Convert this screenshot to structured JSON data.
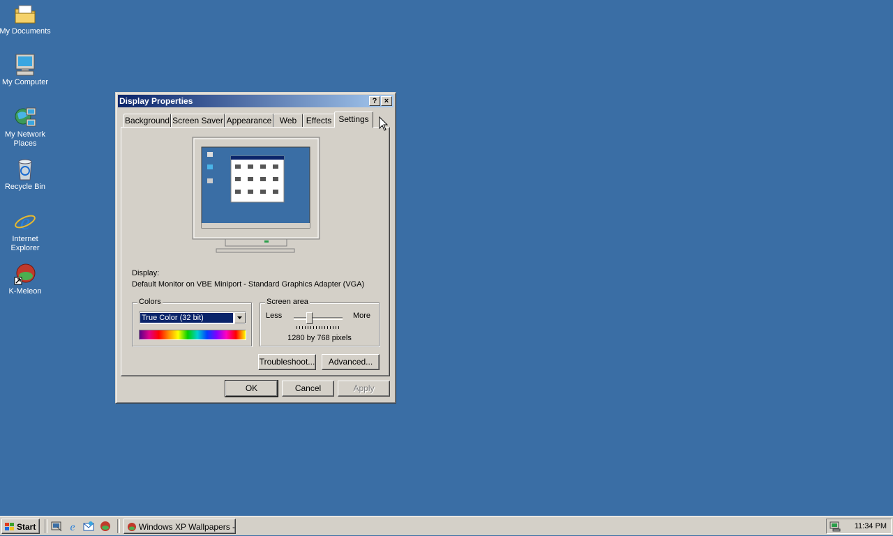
{
  "desktop": {
    "icons": [
      {
        "label": "My Documents",
        "icon": "folder-documents-icon"
      },
      {
        "label": "My Computer",
        "icon": "computer-icon"
      },
      {
        "label": "My Network Places",
        "icon": "network-places-icon"
      },
      {
        "label": "Recycle Bin",
        "icon": "recycle-bin-icon"
      },
      {
        "label": "Internet Explorer",
        "icon": "internet-explorer-icon"
      },
      {
        "label": "K-Meleon",
        "icon": "k-meleon-icon"
      }
    ]
  },
  "window": {
    "title": "Display Properties",
    "help_button": "?",
    "close_button": "×",
    "tabs": [
      {
        "label": "Background"
      },
      {
        "label": "Screen Saver"
      },
      {
        "label": "Appearance"
      },
      {
        "label": "Web"
      },
      {
        "label": "Effects"
      },
      {
        "label": "Settings",
        "active": true
      }
    ],
    "display_label": "Display:",
    "display_value": "Default Monitor on VBE Miniport - Standard Graphics Adapter (VGA)",
    "colors": {
      "label": "Colors",
      "selected": "True Color (32 bit)"
    },
    "screen_area": {
      "label": "Screen area",
      "less": "Less",
      "more": "More",
      "value_text": "1280 by 768 pixels",
      "slider_position": 0.3
    },
    "buttons": {
      "troubleshoot": "Troubleshoot...",
      "advanced": "Advanced...",
      "ok": "OK",
      "cancel": "Cancel",
      "apply": "Apply"
    }
  },
  "taskbar": {
    "start_label": "Start",
    "quick_launch": [
      "show-desktop-icon",
      "internet-explorer-icon",
      "outlook-express-icon",
      "k-meleon-icon"
    ],
    "task_label": "Windows XP Wallpapers - ...",
    "clock": "11:34 PM"
  },
  "colors": {
    "desktop": "#3a6ea5",
    "titlebar_start": "#0a246a",
    "titlebar_end": "#a6caf0",
    "face": "#d4d0c8",
    "selection": "#0a246a"
  }
}
